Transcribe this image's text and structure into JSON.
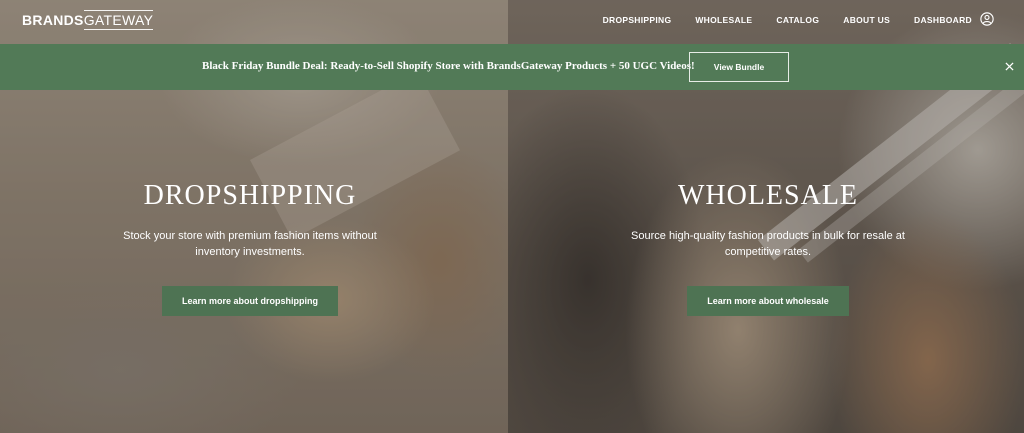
{
  "header": {
    "logo_bold": "BRANDS",
    "logo_light": "GATEWAY",
    "nav": [
      "DROPSHIPPING",
      "WHOLESALE",
      "CATALOG",
      "ABOUT US",
      "DASHBOARD"
    ],
    "account_icon": "user-circle-icon"
  },
  "banner": {
    "text": "Black Friday Bundle Deal: Ready-to-Sell Shopify Store with BrandsGateway Products + 50 UGC Videos!",
    "button": "View Bundle",
    "close_icon": "close-icon",
    "color": "#527a57"
  },
  "hero": {
    "left": {
      "title": "DROPSHIPPING",
      "desc_line1": "Stock your store with premium fashion items without",
      "desc_line2": "inventory investments.",
      "button": "Learn more about dropshipping"
    },
    "right": {
      "title": "WHOLESALE",
      "desc_line1": "Source high-quality fashion products in bulk for resale at",
      "desc_line2": "competitive rates.",
      "button": "Learn more about wholesale"
    },
    "button_color": "#4e7353"
  }
}
